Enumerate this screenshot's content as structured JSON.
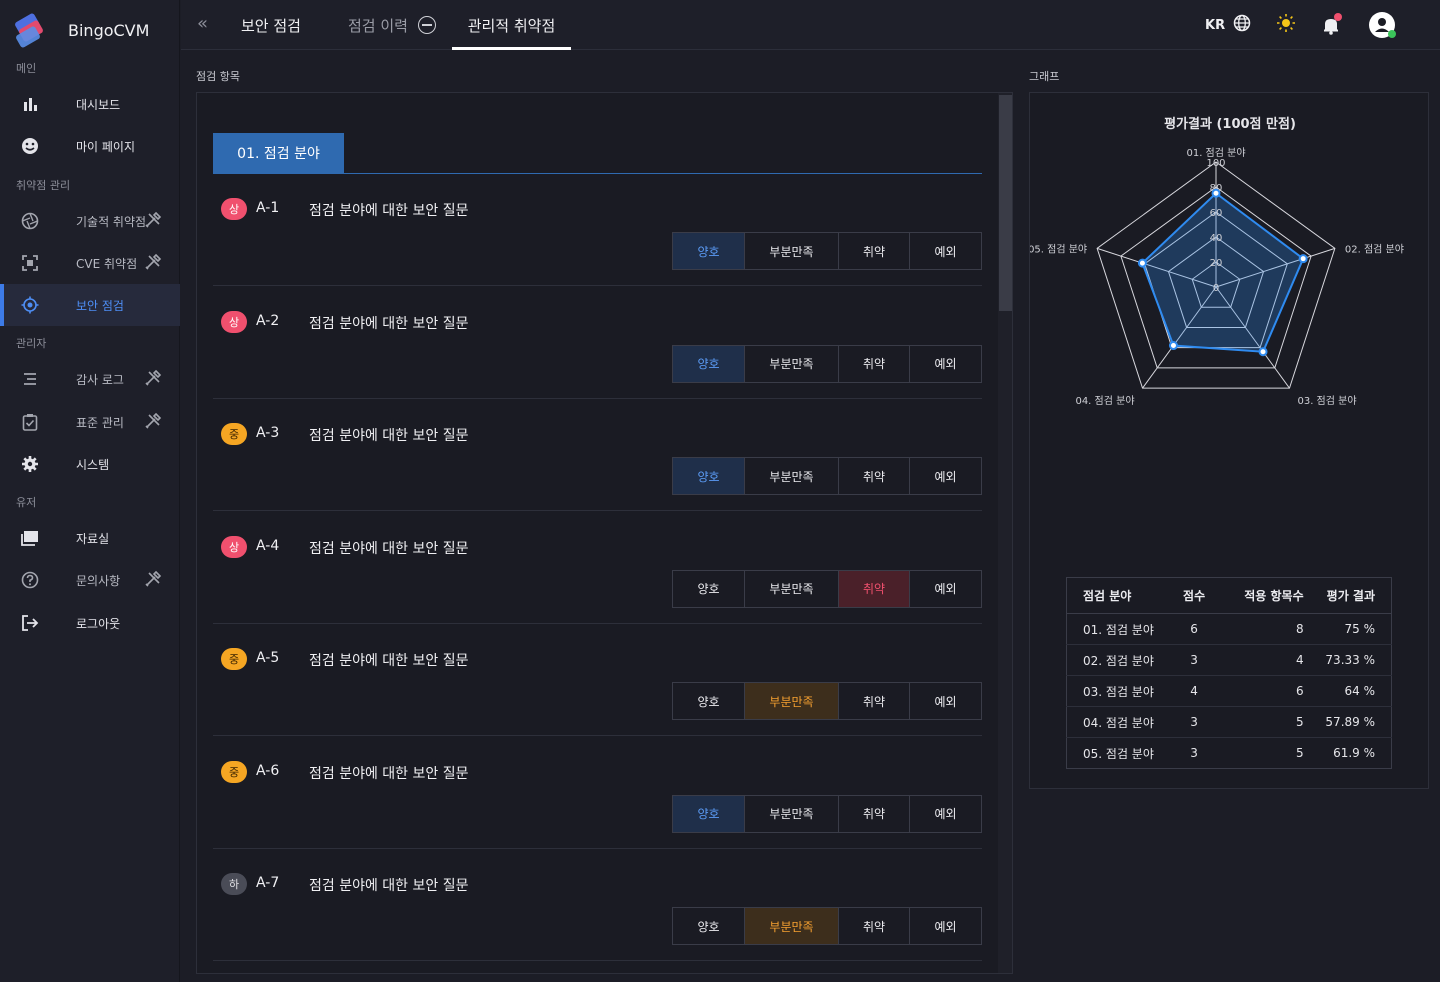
{
  "app": {
    "name": "BingoCVM"
  },
  "sidebar": {
    "sections": [
      "메인",
      "취약점 관리",
      "관리자",
      "유저"
    ],
    "items": [
      {
        "label": "대시보드",
        "icon": "bar-chart-icon"
      },
      {
        "label": "마이 페이지",
        "icon": "smiley-icon"
      },
      {
        "label": "기술적 취약점",
        "icon": "aperture-icon",
        "tool": true
      },
      {
        "label": "CVE 취약점",
        "icon": "scan-frame-icon",
        "tool": true
      },
      {
        "label": "보안 점검",
        "icon": "target-icon",
        "active": true
      },
      {
        "label": "감사 로그",
        "icon": "list-icon",
        "tool": true
      },
      {
        "label": "표준 관리",
        "icon": "clipboard-check-icon",
        "tool": true
      },
      {
        "label": "시스템",
        "icon": "gear-icon"
      },
      {
        "label": "자료실",
        "icon": "folder-icon"
      },
      {
        "label": "문의사항",
        "icon": "question-icon",
        "tool": true
      },
      {
        "label": "로그아웃",
        "icon": "logout-icon"
      }
    ]
  },
  "topbar": {
    "tabs": [
      {
        "label": "보안 점검"
      },
      {
        "label": "점검 이력"
      },
      {
        "label": "관리적 취약점",
        "active": true
      }
    ],
    "lang": "KR"
  },
  "main": {
    "list_title": "점검 항목",
    "graph_title": "그래프",
    "field_tab": "01. 점검 분야",
    "options": [
      "양호",
      "부분만족",
      "취약",
      "예외"
    ],
    "questions": [
      {
        "severity": "상",
        "id": "A-1",
        "text": "점검 분야에 대한 보안 질문",
        "selected": "양호"
      },
      {
        "severity": "상",
        "id": "A-2",
        "text": "점검 분야에 대한 보안 질문",
        "selected": "양호"
      },
      {
        "severity": "중",
        "id": "A-3",
        "text": "점검 분야에 대한 보안 질문",
        "selected": "양호"
      },
      {
        "severity": "상",
        "id": "A-4",
        "text": "점검 분야에 대한 보안 질문",
        "selected": "취약"
      },
      {
        "severity": "중",
        "id": "A-5",
        "text": "점검 분야에 대한 보안 질문",
        "selected": "부분만족"
      },
      {
        "severity": "중",
        "id": "A-6",
        "text": "점검 분야에 대한 보안 질문",
        "selected": "양호"
      },
      {
        "severity": "하",
        "id": "A-7",
        "text": "점검 분야에 대한 보안 질문",
        "selected": "부분만족"
      }
    ]
  },
  "chart_data": {
    "type": "radar",
    "title": "평가결과 (100점 만점)",
    "categories": [
      "01. 점검 분야",
      "02. 점검 분야",
      "03. 점검 분야",
      "04. 점검 분야",
      "05. 점검 분야"
    ],
    "ticks": [
      0,
      20,
      40,
      60,
      80,
      100
    ],
    "values": [
      75,
      73.33,
      64,
      57.89,
      61.9
    ],
    "range": [
      0,
      100
    ],
    "series_color": "#2f8bf0"
  },
  "score_table": {
    "headers": [
      "점검 분야",
      "점수",
      "적용 항목수",
      "평가 결과"
    ],
    "rows": [
      [
        "01. 점검 분야",
        "6",
        "8",
        "75 %"
      ],
      [
        "02. 점검 분야",
        "3",
        "4",
        "73.33 %"
      ],
      [
        "03. 점검 분야",
        "4",
        "6",
        "64 %"
      ],
      [
        "04. 점검 분야",
        "3",
        "5",
        "57.89 %"
      ],
      [
        "05. 점검 분야",
        "3",
        "5",
        "61.9 %"
      ]
    ]
  }
}
